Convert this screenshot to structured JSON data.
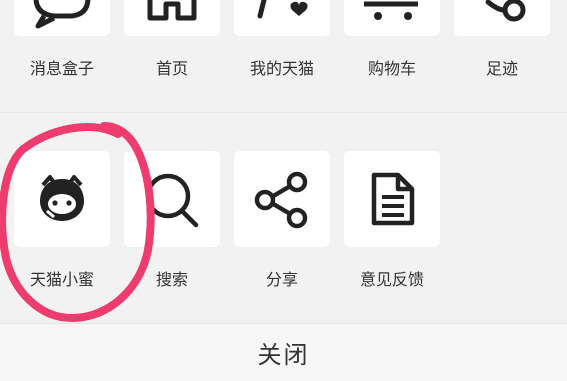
{
  "share_panel": {
    "row1": [
      {
        "label": "消息盒子",
        "icon": "message-bubble-icon"
      },
      {
        "label": "首页",
        "icon": "home-icon"
      },
      {
        "label": "我的天猫",
        "icon": "my-tmall-icon"
      },
      {
        "label": "购物车",
        "icon": "cart-icon"
      },
      {
        "label": "足迹",
        "icon": "footprint-icon"
      }
    ],
    "row2": [
      {
        "label": "天猫小蜜",
        "icon": "tmall-assistant-icon"
      },
      {
        "label": "搜索",
        "icon": "search-icon"
      },
      {
        "label": "分享",
        "icon": "share-icon"
      },
      {
        "label": "意见反馈",
        "icon": "feedback-document-icon"
      }
    ],
    "close_label": "关闭"
  },
  "colors": {
    "background": "#f2f2f2",
    "tile": "#ffffff",
    "icon_stroke": "#222222",
    "annotation_circle": "#ee3c6e"
  }
}
